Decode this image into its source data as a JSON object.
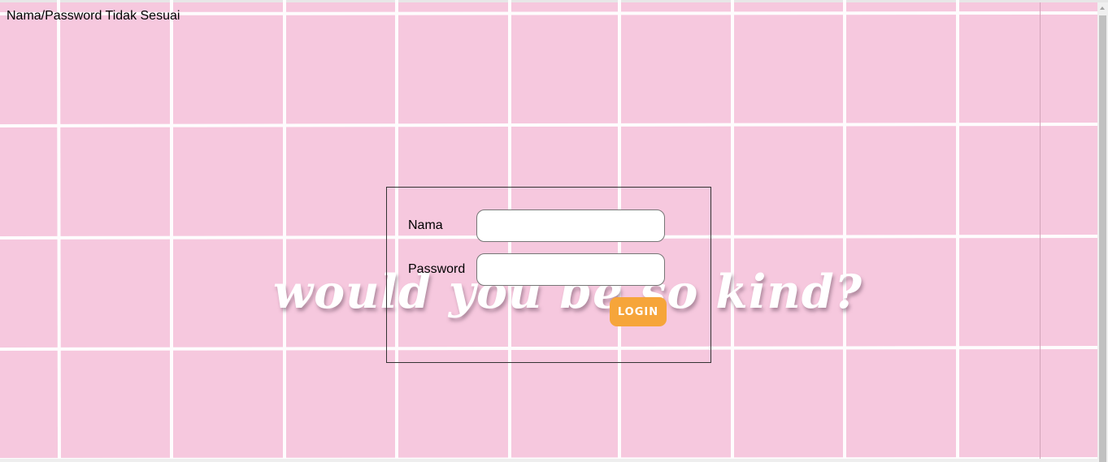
{
  "message": {
    "error_text": "Nama/Password Tidak Sesuai"
  },
  "background": {
    "caption": "would you be so kind?",
    "base_color": "#f6c8de",
    "grid_line_color": "#ffffff"
  },
  "form": {
    "nama_label": "Nama",
    "nama_value": "",
    "nama_placeholder": "",
    "password_label": "Password",
    "password_value": "",
    "password_placeholder": "",
    "login_label": "LOGIN",
    "login_button_color": "#f6a53a"
  }
}
